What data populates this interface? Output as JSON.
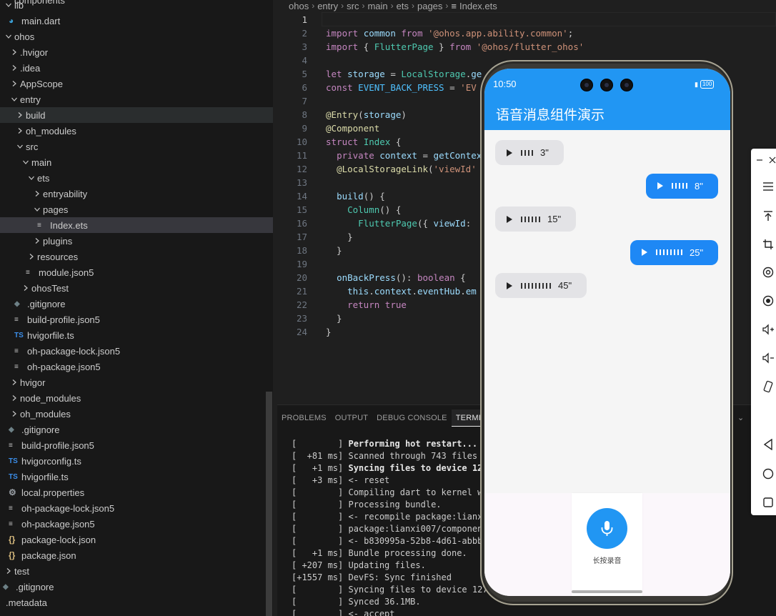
{
  "explorer": {
    "items": [
      {
        "label": "lib",
        "chevron": "down",
        "indent": 0
      },
      {
        "label": "components",
        "clipped": true,
        "indent": 2
      },
      {
        "label": "main.dart",
        "icon": "dart-icon",
        "indent": 1
      },
      {
        "label": "ohos",
        "chevron": "down",
        "indent": 0
      },
      {
        "label": ".hvigor",
        "chevron": "right",
        "indent": 1
      },
      {
        "label": ".idea",
        "chevron": "right",
        "indent": 1
      },
      {
        "label": "AppScope",
        "chevron": "right",
        "indent": 1
      },
      {
        "label": "entry",
        "chevron": "down",
        "indent": 1
      },
      {
        "label": "build",
        "chevron": "right",
        "indent": 2,
        "state": "hover"
      },
      {
        "label": "oh_modules",
        "chevron": "right",
        "indent": 2
      },
      {
        "label": "src",
        "chevron": "down",
        "indent": 2
      },
      {
        "label": "main",
        "chevron": "down",
        "indent": 3
      },
      {
        "label": "ets",
        "chevron": "down",
        "indent": 4
      },
      {
        "label": "entryability",
        "chevron": "right",
        "indent": 5
      },
      {
        "label": "pages",
        "chevron": "down",
        "indent": 5
      },
      {
        "label": "Index.ets",
        "icon": "lines-icon",
        "indent": 6,
        "state": "selected"
      },
      {
        "label": "plugins",
        "chevron": "right",
        "indent": 5
      },
      {
        "label": "resources",
        "chevron": "right",
        "indent": 4
      },
      {
        "label": "module.json5",
        "icon": "lines-icon",
        "indent": 4
      },
      {
        "label": "ohosTest",
        "chevron": "right",
        "indent": 3
      },
      {
        "label": ".gitignore",
        "icon": "git-icon",
        "indent": 2
      },
      {
        "label": "build-profile.json5",
        "icon": "lines-icon",
        "indent": 2
      },
      {
        "label": "hvigorfile.ts",
        "icon": "ts-icon",
        "indent": 2
      },
      {
        "label": "oh-package-lock.json5",
        "icon": "lines-icon",
        "indent": 2
      },
      {
        "label": "oh-package.json5",
        "icon": "lines-icon",
        "indent": 2
      },
      {
        "label": "hvigor",
        "chevron": "right",
        "indent": 1
      },
      {
        "label": "node_modules",
        "chevron": "right",
        "indent": 1
      },
      {
        "label": "oh_modules",
        "chevron": "right",
        "indent": 1
      },
      {
        "label": ".gitignore",
        "icon": "git-icon",
        "indent": 1
      },
      {
        "label": "build-profile.json5",
        "icon": "lines-icon",
        "indent": 1
      },
      {
        "label": "hvigorconfig.ts",
        "icon": "ts-icon",
        "indent": 1
      },
      {
        "label": "hvigorfile.ts",
        "icon": "ts-icon",
        "indent": 1
      },
      {
        "label": "local.properties",
        "icon": "gear-icon",
        "indent": 1
      },
      {
        "label": "oh-package-lock.json5",
        "icon": "lines-icon",
        "indent": 1
      },
      {
        "label": "oh-package.json5",
        "icon": "lines-icon",
        "indent": 1
      },
      {
        "label": "package-lock.json",
        "icon": "json-icon",
        "indent": 1
      },
      {
        "label": "package.json",
        "icon": "json-icon",
        "indent": 1
      },
      {
        "label": "test",
        "chevron": "right",
        "indent": 0
      },
      {
        "label": ".gitignore",
        "icon": "git-icon",
        "indent": 0
      },
      {
        "label": ".metadata",
        "icon": "none",
        "indent": 0
      }
    ]
  },
  "editor": {
    "breadcrumbs": [
      "ohos",
      "entry",
      "src",
      "main",
      "ets",
      "pages",
      "Index.ets"
    ],
    "lines": [
      {
        "n": "1",
        "text": ""
      },
      {
        "n": "2",
        "text": "import common from '@ohos.app.ability.common';"
      },
      {
        "n": "3",
        "text": "import { FlutterPage } from '@ohos/flutter_ohos'"
      },
      {
        "n": "4",
        "text": ""
      },
      {
        "n": "5",
        "text": "let storage = LocalStorage.ge"
      },
      {
        "n": "6",
        "text": "const EVENT_BACK_PRESS = 'EV"
      },
      {
        "n": "7",
        "text": ""
      },
      {
        "n": "8",
        "text": "@Entry(storage)"
      },
      {
        "n": "9",
        "text": "@Component"
      },
      {
        "n": "10",
        "text": "struct Index {"
      },
      {
        "n": "11",
        "text": "  private context = getContex"
      },
      {
        "n": "12",
        "text": "  @LocalStorageLink('viewId'"
      },
      {
        "n": "13",
        "text": ""
      },
      {
        "n": "14",
        "text": "  build() {"
      },
      {
        "n": "15",
        "text": "    Column() {"
      },
      {
        "n": "16",
        "text": "      FlutterPage({ viewId: "
      },
      {
        "n": "17",
        "text": "    }"
      },
      {
        "n": "18",
        "text": "  }"
      },
      {
        "n": "19",
        "text": ""
      },
      {
        "n": "20",
        "text": "  onBackPress(): boolean {"
      },
      {
        "n": "21",
        "text": "    this.context.eventHub.em"
      },
      {
        "n": "22",
        "text": "    return true"
      },
      {
        "n": "23",
        "text": "  }"
      },
      {
        "n": "24",
        "text": "}"
      }
    ]
  },
  "panel": {
    "tabs": [
      "PROBLEMS",
      "OUTPUT",
      "DEBUG CONSOLE",
      "TERMINAL"
    ],
    "active_tab": "TERMINAL",
    "terminal_lines": [
      {
        "prefix": "[        ] ",
        "text": "Performing hot restart...",
        "bold": true
      },
      {
        "prefix": "[  +81 ms] ",
        "text": "Scanned through 743 files i",
        "bold": false
      },
      {
        "prefix": "[   +1 ms] ",
        "text": "Syncing files to device 127",
        "bold": true
      },
      {
        "prefix": "[   +3 ms] ",
        "text": "<- reset",
        "bold": false
      },
      {
        "prefix": "[        ] ",
        "text": "Compiling dart to kernel wi",
        "bold": false
      },
      {
        "prefix": "[        ] ",
        "text": "Processing bundle.",
        "bold": false
      },
      {
        "prefix": "[        ] ",
        "text": "<- recompile package:lianxi",
        "bold": false
      },
      {
        "prefix": "[        ] ",
        "text": "package:lianxi007/component",
        "bold": false
      },
      {
        "prefix": "[        ] ",
        "text": "<- b830995a-52b8-4d61-abbb-",
        "bold": false
      },
      {
        "prefix": "[   +1 ms] ",
        "text": "Bundle processing done.",
        "bold": false
      },
      {
        "prefix": "[ +207 ms] ",
        "text": "Updating files.",
        "bold": false
      },
      {
        "prefix": "[+1557 ms] ",
        "text": "DevFS: Sync finished",
        "bold": false
      },
      {
        "prefix": "[        ] ",
        "text": "Syncing files to device 127.",
        "bold": false
      },
      {
        "prefix": "[        ] ",
        "text": "Synced 36.1MB.",
        "bold": false
      },
      {
        "prefix": "[        ] ",
        "text": "<- accept",
        "bold": false
      }
    ]
  },
  "phone": {
    "status": {
      "time": "10:50",
      "battery": "100"
    },
    "app_title": "语音消息组件演示",
    "messages": [
      {
        "direction": "received",
        "duration": "3\"",
        "bars": 4
      },
      {
        "direction": "sent",
        "duration": "8\"",
        "bars": 5
      },
      {
        "direction": "received",
        "duration": "15\"",
        "bars": 6
      },
      {
        "direction": "sent",
        "duration": "25\"",
        "bars": 8
      },
      {
        "direction": "received",
        "duration": "45\"",
        "bars": 9
      }
    ],
    "record_label": "长按录音",
    "colors": {
      "primary": "#2196f3",
      "sent_bubble": "#1e88f5",
      "received_bubble": "#e3e3e6"
    }
  },
  "emulator_toolbar": {
    "tools": [
      "minimize-icon",
      "close-icon",
      "menu-icon",
      "pin-top-icon",
      "crop-icon",
      "screenshot-icon",
      "record-icon",
      "volume-up-icon",
      "volume-down-icon",
      "rotate-icon",
      "back-icon",
      "home-icon",
      "recents-icon"
    ]
  }
}
